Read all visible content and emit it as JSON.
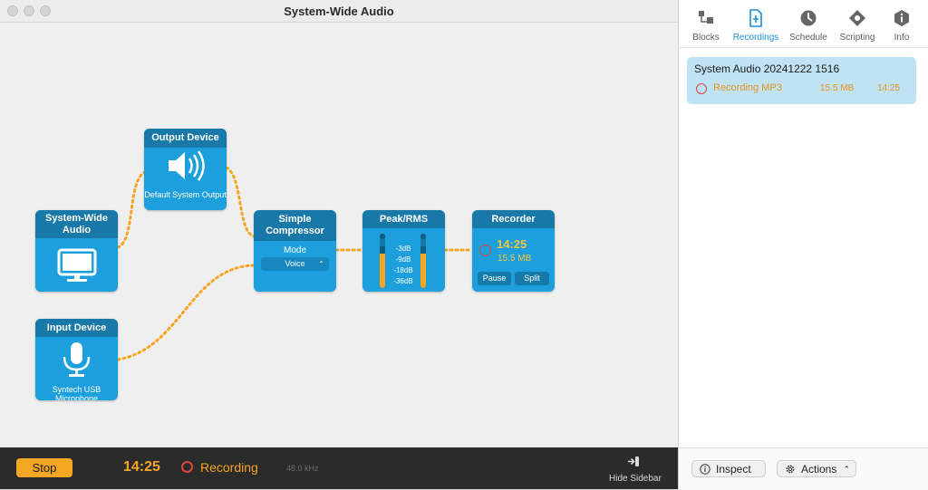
{
  "window": {
    "title": "System-Wide Audio"
  },
  "blocks": {
    "system_audio": {
      "title": "System-Wide Audio"
    },
    "output_device": {
      "title": "Output Device",
      "label": "Default System Output"
    },
    "input_device": {
      "title": "Input Device",
      "label": "Syntech USB Microphone"
    },
    "compressor": {
      "title": "Simple Compressor",
      "mode_label": "Mode",
      "mode_value": "Voice"
    },
    "peak_rms": {
      "title": "Peak/RMS",
      "scale": [
        "-3dB",
        "-9dB",
        "-18dB",
        "-36dB"
      ]
    },
    "recorder": {
      "title": "Recorder",
      "time": "14:25",
      "size": "15.5 MB",
      "pause_label": "Pause",
      "split_label": "Split"
    }
  },
  "statusbar": {
    "stop_label": "Stop",
    "time": "14:25",
    "status": "Recording",
    "sample_rate": "48.0 kHz",
    "hide_sidebar_label": "Hide Sidebar"
  },
  "sidebar": {
    "tabs": [
      {
        "label": "Blocks",
        "icon": "blocks-icon"
      },
      {
        "label": "Recordings",
        "icon": "recordings-icon",
        "active": true
      },
      {
        "label": "Schedule",
        "icon": "clock-icon"
      },
      {
        "label": "Scripting",
        "icon": "scripting-icon"
      },
      {
        "label": "Info",
        "icon": "info-icon"
      }
    ],
    "recordings": [
      {
        "name": "System Audio 20241222 1516",
        "status": "Recording MP3",
        "size": "15.5 MB",
        "duration": "14:25"
      }
    ],
    "inspect_label": "Inspect",
    "actions_label": "Actions"
  },
  "colors": {
    "block": "#1c9fdc",
    "block_header": "#1879a8",
    "accent": "#f5a623",
    "record": "#e0463a",
    "selection": "#bfe3f5"
  }
}
